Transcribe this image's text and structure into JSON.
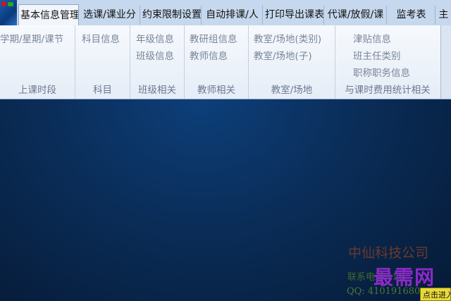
{
  "tabs": [
    {
      "label": "基本信息管理"
    },
    {
      "label": "选课/课业分"
    },
    {
      "label": "约束限制设置"
    },
    {
      "label": "自动排课/人"
    },
    {
      "label": "打印导出课表"
    },
    {
      "label": "代课/放假/课"
    },
    {
      "label": "监考表"
    },
    {
      "label": "主"
    }
  ],
  "ribbon": {
    "groups": [
      {
        "title": "上课时段",
        "items": [
          "学期/星期/课节"
        ]
      },
      {
        "title": "科目",
        "items": [
          "科目信息"
        ]
      },
      {
        "title": "班级相关",
        "items": [
          "年级信息",
          "班级信息"
        ]
      },
      {
        "title": "教师相关",
        "items": [
          "教研组信息",
          "教师信息"
        ]
      },
      {
        "title": "教室/场地",
        "items": [
          "教室/场地(类别)",
          "教室/场地(子)"
        ]
      },
      {
        "title": "与课时费用统计相关",
        "items": [
          "津贴信息",
          "班主任类别",
          "职称职务信息"
        ]
      }
    ]
  },
  "desktop": {
    "company": "中仙科技公司",
    "contact": "联系电话:158",
    "qq": "QQ: 410191680",
    "watermark": "最需网",
    "click_button": "点击进入"
  },
  "colors": {
    "desktop_bg": "#0a2d58",
    "ribbon_bg": "#eef3fa",
    "tabbar_bg": "#c6d8ee"
  }
}
